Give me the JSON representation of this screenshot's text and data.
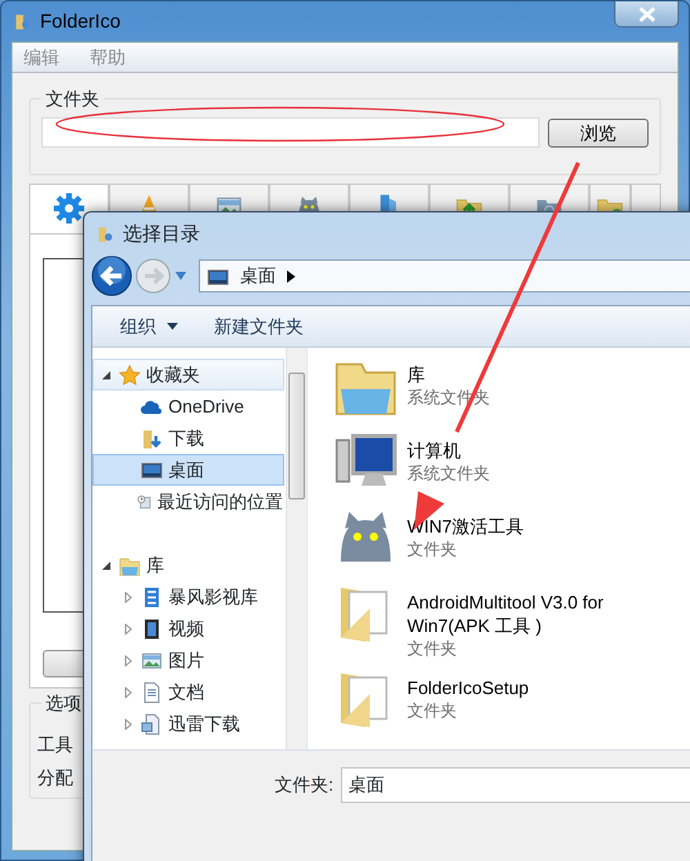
{
  "window": {
    "title": "FolderIco"
  },
  "menu": [
    {
      "label": "编辑",
      "disabled": true
    },
    {
      "label": "帮助",
      "disabled": true
    }
  ],
  "folder_group": {
    "title": "文件夹",
    "browse_button": "浏览"
  },
  "icon_tabs": [
    {
      "kind": "gear",
      "selected": true
    },
    {
      "kind": "cone",
      "selected": false
    },
    {
      "kind": "picture",
      "selected": false
    },
    {
      "kind": "cat",
      "selected": false
    },
    {
      "kind": "bluefolder",
      "selected": false
    },
    {
      "kind": "arrowfolder",
      "selected": false
    },
    {
      "kind": "greyfolder",
      "selected": false
    },
    {
      "kind": "greenfolder",
      "selected": false
    },
    {
      "kind": "blank",
      "selected": false
    }
  ],
  "options_group": {
    "title": "选项",
    "rows": [
      "工具",
      "分配"
    ]
  },
  "dialog": {
    "title": "选择目录",
    "breadcrumb": "桌面",
    "toolbar": [
      {
        "label": "组织",
        "dropdown": true
      },
      {
        "label": "新建文件夹",
        "dropdown": false
      }
    ],
    "nav": [
      {
        "label": "收藏夹",
        "kind": "star",
        "expanded": true,
        "selected": false,
        "highlighted": true,
        "children": [
          {
            "label": "OneDrive",
            "kind": "cloud",
            "selected": false,
            "highlighted": false
          },
          {
            "label": "下载",
            "kind": "downloads",
            "selected": false,
            "highlighted": false
          },
          {
            "label": "桌面",
            "kind": "desktop",
            "selected": true,
            "highlighted": false
          },
          {
            "label": "最近访问的位置",
            "kind": "recent",
            "selected": false,
            "highlighted": false
          }
        ]
      },
      {
        "label": "库",
        "kind": "library",
        "expanded": true,
        "selected": false,
        "highlighted": false,
        "children": [
          {
            "label": "暴风影视库",
            "kind": "film",
            "expanded": false,
            "selected": false,
            "highlighted": false
          },
          {
            "label": "视频",
            "kind": "video",
            "expanded": false,
            "selected": false,
            "highlighted": false
          },
          {
            "label": "图片",
            "kind": "picture",
            "expanded": false,
            "selected": false,
            "highlighted": false
          },
          {
            "label": "文档",
            "kind": "document",
            "expanded": false,
            "selected": false,
            "highlighted": false
          },
          {
            "label": "迅雷下载",
            "kind": "document2",
            "expanded": false,
            "selected": false,
            "highlighted": false
          }
        ]
      }
    ],
    "files": [
      {
        "name": "库",
        "type": "系统文件夹",
        "kind": "library"
      },
      {
        "name": "计算机",
        "type": "系统文件夹",
        "kind": "computer"
      },
      {
        "name": "WIN7激活工具",
        "type": "文件夹",
        "kind": "cat"
      },
      {
        "name": "AndroidMultitool V3.0 for Win7(APK 工具 )",
        "type": "文件夹",
        "kind": "folder"
      },
      {
        "name": "FolderIcoSetup",
        "type": "文件夹",
        "kind": "folder"
      }
    ],
    "folder_field": {
      "label": "文件夹:",
      "value": "桌面"
    }
  }
}
